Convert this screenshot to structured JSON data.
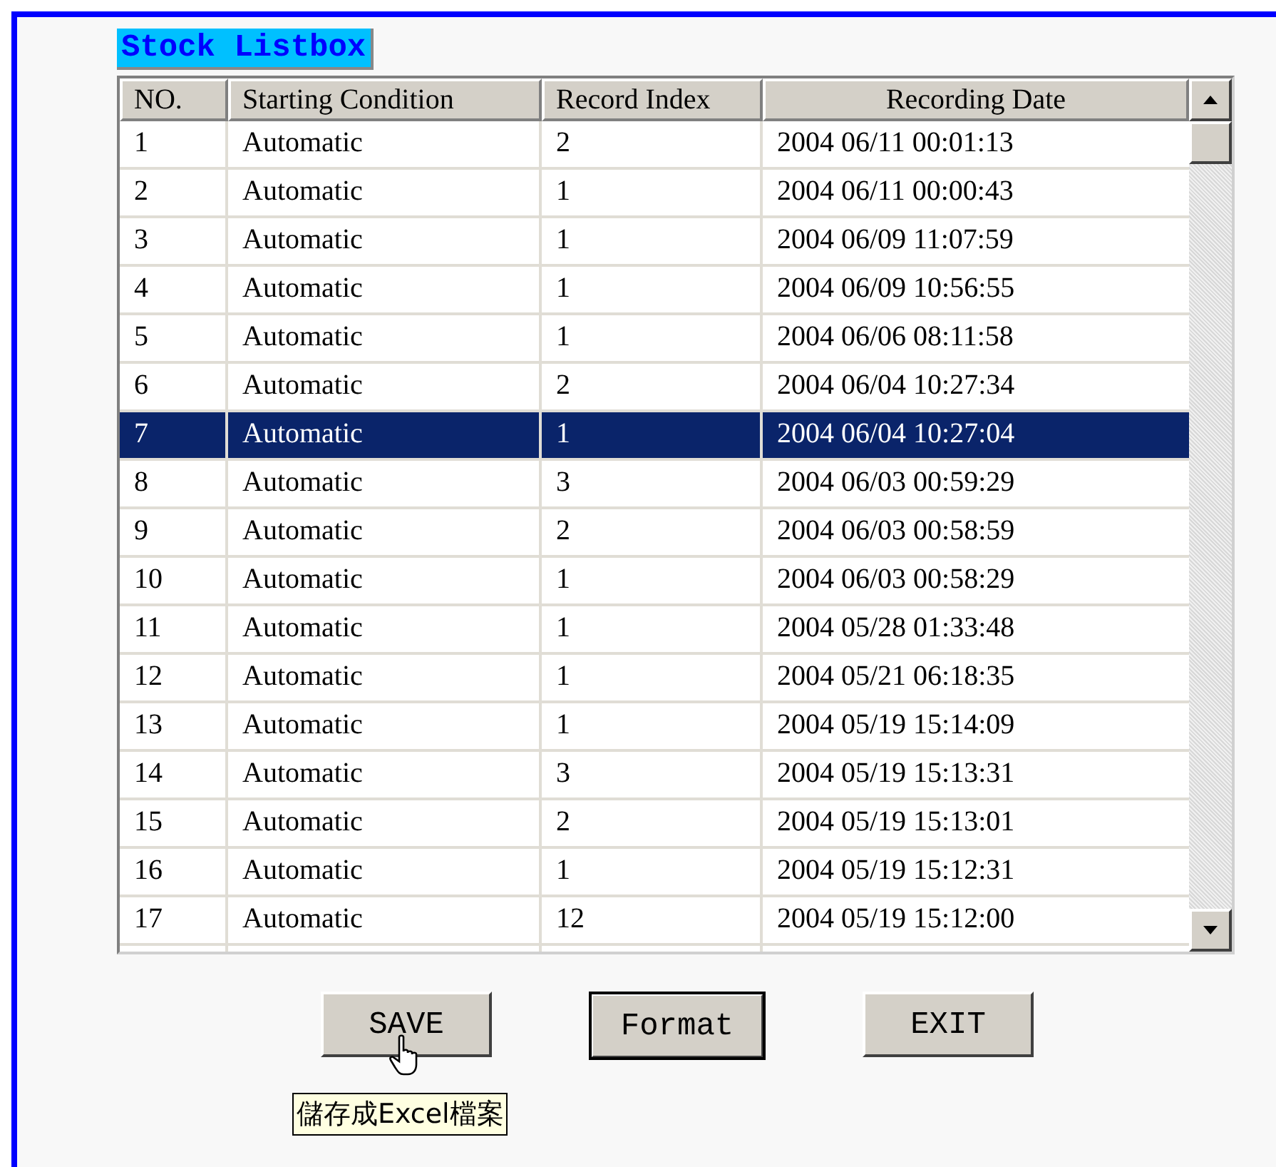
{
  "title": "Stock Listbox",
  "table": {
    "columns": [
      "NO.",
      "Starting Condition",
      "Record Index",
      "Recording Date"
    ],
    "rows": [
      {
        "cells": [
          "1",
          "Automatic",
          "2",
          "2004 06/11 00:01:13"
        ],
        "selected": false
      },
      {
        "cells": [
          "2",
          "Automatic",
          "1",
          "2004 06/11 00:00:43"
        ],
        "selected": false
      },
      {
        "cells": [
          "3",
          "Automatic",
          "1",
          "2004 06/09 11:07:59"
        ],
        "selected": false
      },
      {
        "cells": [
          "4",
          "Automatic",
          "1",
          "2004 06/09 10:56:55"
        ],
        "selected": false
      },
      {
        "cells": [
          "5",
          "Automatic",
          "1",
          "2004 06/06 08:11:58"
        ],
        "selected": false
      },
      {
        "cells": [
          "6",
          "Automatic",
          "2",
          "2004 06/04 10:27:34"
        ],
        "selected": false
      },
      {
        "cells": [
          "7",
          "Automatic",
          "1",
          "2004 06/04 10:27:04"
        ],
        "selected": true
      },
      {
        "cells": [
          "8",
          "Automatic",
          "3",
          "2004 06/03 00:59:29"
        ],
        "selected": false
      },
      {
        "cells": [
          "9",
          "Automatic",
          "2",
          "2004 06/03 00:58:59"
        ],
        "selected": false
      },
      {
        "cells": [
          "10",
          "Automatic",
          "1",
          "2004 06/03 00:58:29"
        ],
        "selected": false
      },
      {
        "cells": [
          "11",
          "Automatic",
          "1",
          "2004 05/28 01:33:48"
        ],
        "selected": false
      },
      {
        "cells": [
          "12",
          "Automatic",
          "1",
          "2004 05/21 06:18:35"
        ],
        "selected": false
      },
      {
        "cells": [
          "13",
          "Automatic",
          "1",
          "2004 05/19 15:14:09"
        ],
        "selected": false
      },
      {
        "cells": [
          "14",
          "Automatic",
          "3",
          "2004 05/19 15:13:31"
        ],
        "selected": false
      },
      {
        "cells": [
          "15",
          "Automatic",
          "2",
          "2004 05/19 15:13:01"
        ],
        "selected": false
      },
      {
        "cells": [
          "16",
          "Automatic",
          "1",
          "2004 05/19 15:12:31"
        ],
        "selected": false
      },
      {
        "cells": [
          "17",
          "Automatic",
          "12",
          "2004 05/19 15:12:00"
        ],
        "selected": false
      }
    ]
  },
  "buttons": [
    {
      "label": "SAVE",
      "default": false
    },
    {
      "label": "Format",
      "default": true
    },
    {
      "label": "EXIT",
      "default": false
    }
  ],
  "tooltip": "儲存成Excel檔案"
}
